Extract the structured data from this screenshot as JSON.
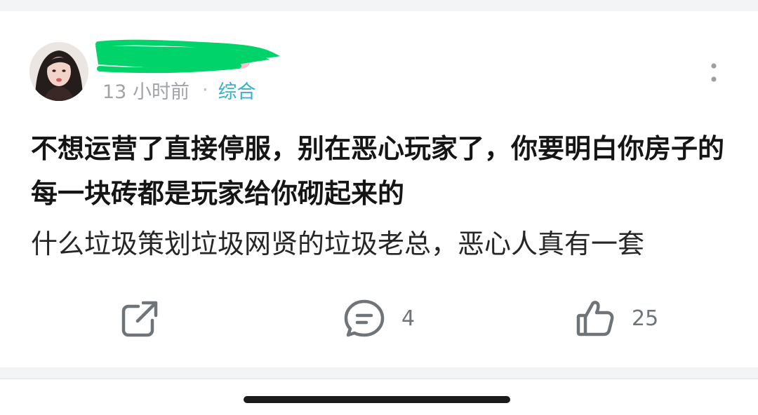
{
  "post": {
    "author": {
      "name": "",
      "name_hidden": true
    },
    "meta": {
      "time": "13 小时前",
      "separator": "·",
      "category": "综合"
    },
    "title": "不想运营了直接停服，别在恶心玩家了，你要明白你房子的每一块砖都是玩家给你砌起来的",
    "content": "什么垃圾策划垃圾网贤的垃圾老总，恶心人真有一套",
    "actions": {
      "comment_count": "4",
      "like_count": "25"
    }
  },
  "icons": {
    "more": "more-vertical-icon",
    "share": "share-icon",
    "comment": "comment-icon",
    "like": "thumbs-up-icon"
  },
  "colors": {
    "category": "#35b3c9",
    "redaction": "#00d36a",
    "muted": "#a0a4a8",
    "action_icon": "#6f7478"
  }
}
